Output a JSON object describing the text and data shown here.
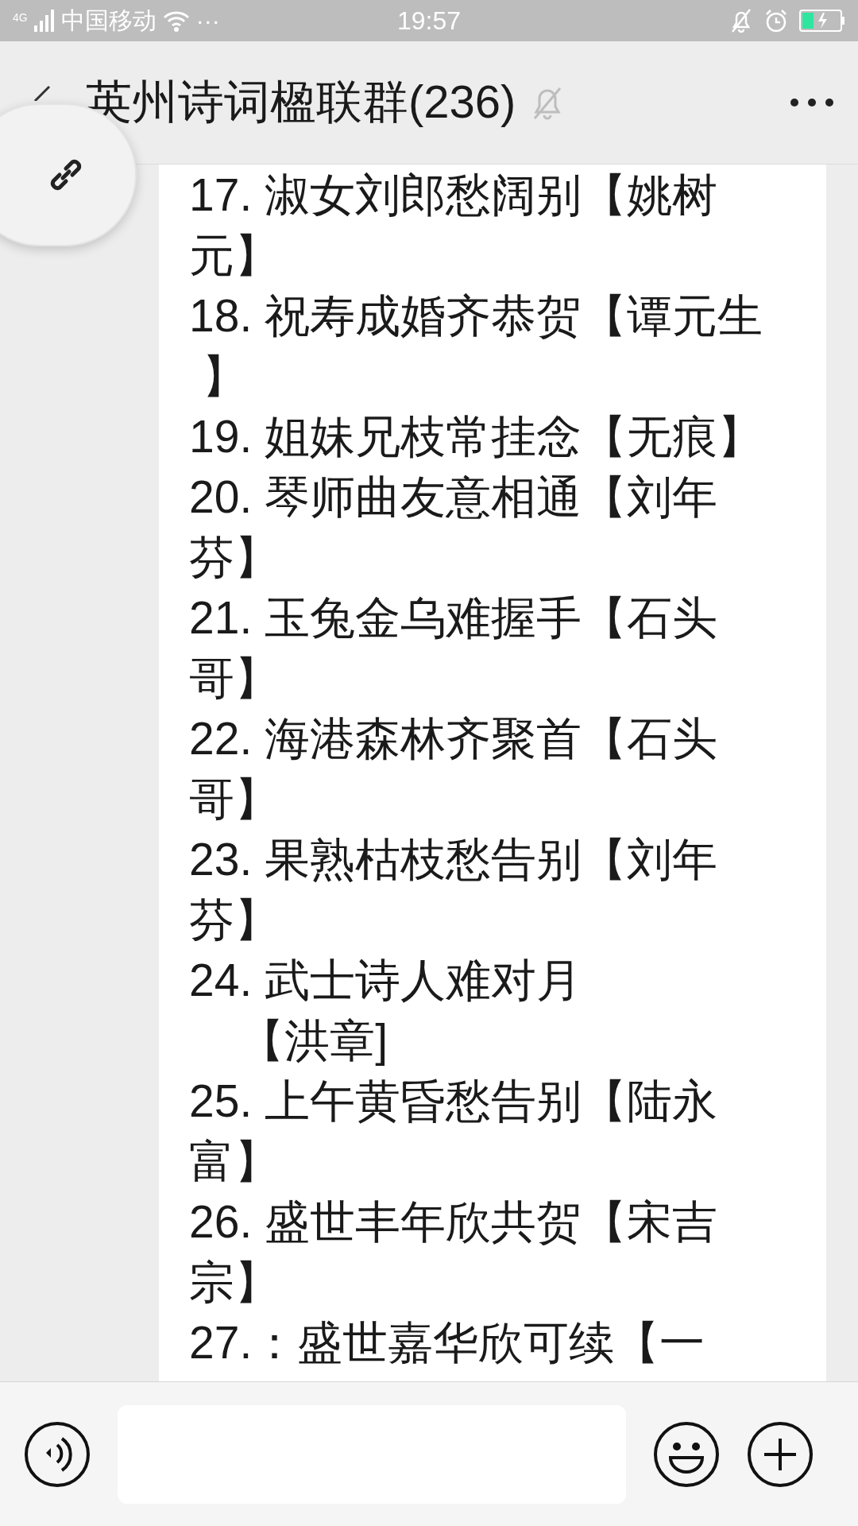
{
  "status_bar": {
    "network": "4G",
    "carrier": "中国移动",
    "more": "···",
    "time": "19:57"
  },
  "header": {
    "title": "英州诗词楹联群(236)",
    "muted": true
  },
  "message": {
    "items": [
      {
        "lines": [
          "17. 淑女刘郎愁阔别【姚树",
          "元】"
        ]
      },
      {
        "lines": [
          "18. 祝寿成婚齐恭贺【谭元生",
          " 】"
        ]
      },
      {
        "lines": [
          "19. 姐妹兄枝常挂念【无痕】"
        ]
      },
      {
        "lines": [
          "20. 琴师曲友意相通【刘年",
          "芬】"
        ]
      },
      {
        "lines": [
          "21. 玉兔金乌难握手【石头",
          "哥】"
        ]
      },
      {
        "lines": [
          "22. 海港森林齐聚首【石头",
          "哥】"
        ]
      },
      {
        "lines": [
          "23. 果熟枯枝愁告别【刘年",
          "芬】"
        ]
      },
      {
        "lines": [
          "24. 武士诗人难对月",
          "    【洪章]"
        ]
      },
      {
        "lines": [
          "25. 上午黄昏愁告别【陆永",
          "富】"
        ]
      },
      {
        "lines": [
          "26. 盛世丰年欣共贺【宋吉",
          "宗】"
        ]
      },
      {
        "lines": [
          "27.：盛世嘉华欣可续【一"
        ]
      }
    ]
  }
}
